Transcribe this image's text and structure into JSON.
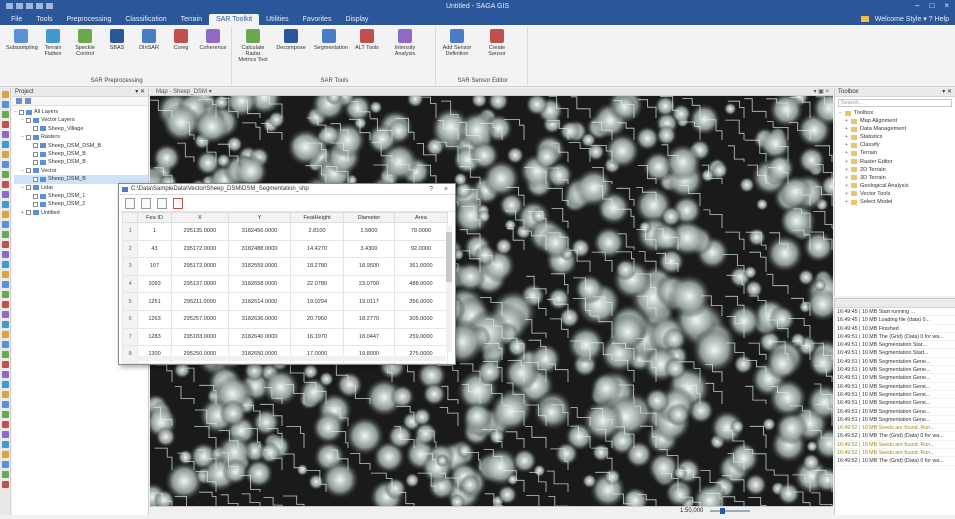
{
  "titlebar": {
    "title": "Untitled - SAGA GIS"
  },
  "menu": {
    "tabs": [
      "File",
      "Tools",
      "Preprocessing",
      "Classification",
      "Terrain",
      "SAR Toolkit",
      "Utilities",
      "Favorites",
      "Display"
    ],
    "active_index": 5,
    "right_text": "Welcome  Style ▾  ?  Help"
  },
  "ribbon": {
    "groups": [
      {
        "label": "SAR Preprocessing",
        "buttons": [
          "Subsampling",
          "Terrain Flatten",
          "Speckle Control",
          "SBAS",
          "DInSAR",
          "Coreg",
          "Coherence"
        ]
      },
      {
        "label": "SAR Tools",
        "buttons": [
          "Calculate Radar Metrics Tool",
          "Decompose",
          "Segmentation",
          "ALT Tools",
          "Intensity Analysis"
        ]
      },
      {
        "label": "SAR Sensor Editor",
        "buttons": [
          "Add Sensor Definition",
          "Create Sensor"
        ]
      }
    ]
  },
  "project_panel": {
    "title": "Project",
    "tree": [
      {
        "indent": 0,
        "label": "All Layers",
        "expand": "−"
      },
      {
        "indent": 1,
        "label": "Vector Layers",
        "expand": "−"
      },
      {
        "indent": 2,
        "label": "Sheep_Village",
        "expand": ""
      },
      {
        "indent": 1,
        "label": "Rasters",
        "expand": "−"
      },
      {
        "indent": 2,
        "label": "Sheep_DSM_DSM_B",
        "expand": ""
      },
      {
        "indent": 2,
        "label": "Sheep_DSM_B",
        "expand": ""
      },
      {
        "indent": 2,
        "label": "Sheep_DSM_B",
        "expand": ""
      },
      {
        "indent": 1,
        "label": "Vector",
        "expand": "−"
      },
      {
        "indent": 2,
        "label": "Sheep_DSM_B",
        "expand": "",
        "selected": true
      },
      {
        "indent": 1,
        "label": "Lidar",
        "expand": "−"
      },
      {
        "indent": 2,
        "label": "Sheep_DSM_1",
        "expand": ""
      },
      {
        "indent": 2,
        "label": "Sheep_DSM_2",
        "expand": ""
      },
      {
        "indent": 1,
        "label": "Untitled",
        "expand": "+"
      }
    ]
  },
  "map": {
    "tab_label": "Map - Sheep_DSM ▾",
    "tab_right": "▾ ▣ ×",
    "scale_label": "1:50,000"
  },
  "toolbox": {
    "title": "Toolbox",
    "search_placeholder": "Search...",
    "items": [
      {
        "label": "Toolbox",
        "expand": "−"
      },
      {
        "label": "Map Alignment",
        "expand": "+"
      },
      {
        "label": "Data Management",
        "expand": "+"
      },
      {
        "label": "Statistics",
        "expand": "+"
      },
      {
        "label": "Classify",
        "expand": "+"
      },
      {
        "label": "Terrain",
        "expand": "+"
      },
      {
        "label": "Raster Editor",
        "expand": "+"
      },
      {
        "label": "2D Terrain",
        "expand": "+"
      },
      {
        "label": "3D Terrain",
        "expand": "+"
      },
      {
        "label": "Geological Analysis",
        "expand": "+"
      },
      {
        "label": "Vector Tools",
        "expand": "+"
      },
      {
        "label": "Select Model",
        "expand": "+"
      }
    ]
  },
  "log": {
    "rows": [
      {
        "text": "16:49:45 | 10 MB   Start running ...",
        "warn": false
      },
      {
        "text": "16:49:45 | 10 MB   Loading file (data) 0...",
        "warn": false
      },
      {
        "text": "16:49:45 | 10 MB   Finished",
        "warn": false
      },
      {
        "text": "16:49:51 | 10 MB   The (Grid) (Data) 0 for wa...",
        "warn": false
      },
      {
        "text": "16:49:51 | 10 MB   Segmentation   Star...",
        "warn": false
      },
      {
        "text": "16:49:51 | 10 MB   Segmentation   Start...",
        "warn": false
      },
      {
        "text": "16:49:51 | 10 MB   Segmentation   Gene...",
        "warn": false
      },
      {
        "text": "16:49:51 | 10 MB   Segmentation   Gene...",
        "warn": false
      },
      {
        "text": "16:49:51 | 10 MB   Segmentation   Gene...",
        "warn": false
      },
      {
        "text": "16:49:51 | 10 MB   Segmentation   Gene...",
        "warn": false
      },
      {
        "text": "16:49:51 | 10 MB   Segmentation   Gene...",
        "warn": false
      },
      {
        "text": "16:49:51 | 10 MB   Segmentation   Gene...",
        "warn": false
      },
      {
        "text": "16:49:51 | 10 MB   Segmentation   Gene...",
        "warn": false
      },
      {
        "text": "16:49:51 | 10 MB   Segmentation   Gene...",
        "warn": false
      },
      {
        "text": "16:49:52 | 10 MB   Seeds are found. Run...",
        "warn": true
      },
      {
        "text": "16:49:52 | 10 MB   The (Grid) (Data) 0 for wa...",
        "warn": false
      },
      {
        "text": "16:49:52 | 10 MB   Seeds are found. Run...",
        "warn": true
      },
      {
        "text": "16:49:52 | 10 MB   Seeds are found. Run...",
        "warn": true
      },
      {
        "text": "16:49:52 | 10 MB   The (Grid) (Data) 0 for wa...",
        "warn": false
      }
    ]
  },
  "attribute_table": {
    "title": "C:\\Data\\SampleData\\Vector\\Sheep_DSM\\DSM_Segmentation_shp",
    "controls": [
      "?",
      "×"
    ],
    "columns": [
      "",
      "Fea ID",
      "X",
      "Y",
      "FeatHeight",
      "Diameter",
      "Area"
    ],
    "rows": [
      [
        "1",
        "1",
        "295135.0000",
        "3182456.0000",
        "2.8100",
        "1.5800",
        "79.0000"
      ],
      [
        "2",
        "43",
        "295172.0000",
        "3182488.0000",
        "14.4270",
        "3.4300",
        "92.0000"
      ],
      [
        "3",
        "107",
        "295172.0000",
        "3182559.0000",
        "18.2780",
        "18.9500",
        "361.0000"
      ],
      [
        "4",
        "1093",
        "295137.0000",
        "3182658.0000",
        "22.0780",
        "23.0700",
        "488.0000"
      ],
      [
        "5",
        "1251",
        "295211.0000",
        "3182614.0000",
        "19.0294",
        "19.0117",
        "356.0000"
      ],
      [
        "6",
        "1263",
        "295257.0000",
        "3182636.0000",
        "20.7960",
        "18.2770",
        "305.0000"
      ],
      [
        "7",
        "1283",
        "295183.0000",
        "3182640.0000",
        "16.1970",
        "18.0447",
        "259.0000"
      ],
      [
        "8",
        "1300",
        "295250.0000",
        "3182650.0000",
        "17.0000",
        "19.8000",
        "275.0000"
      ]
    ]
  },
  "colors": {
    "brand": "#2b579a",
    "map_background": "#1a1a1a",
    "segment_lines": "#dcefe9"
  }
}
